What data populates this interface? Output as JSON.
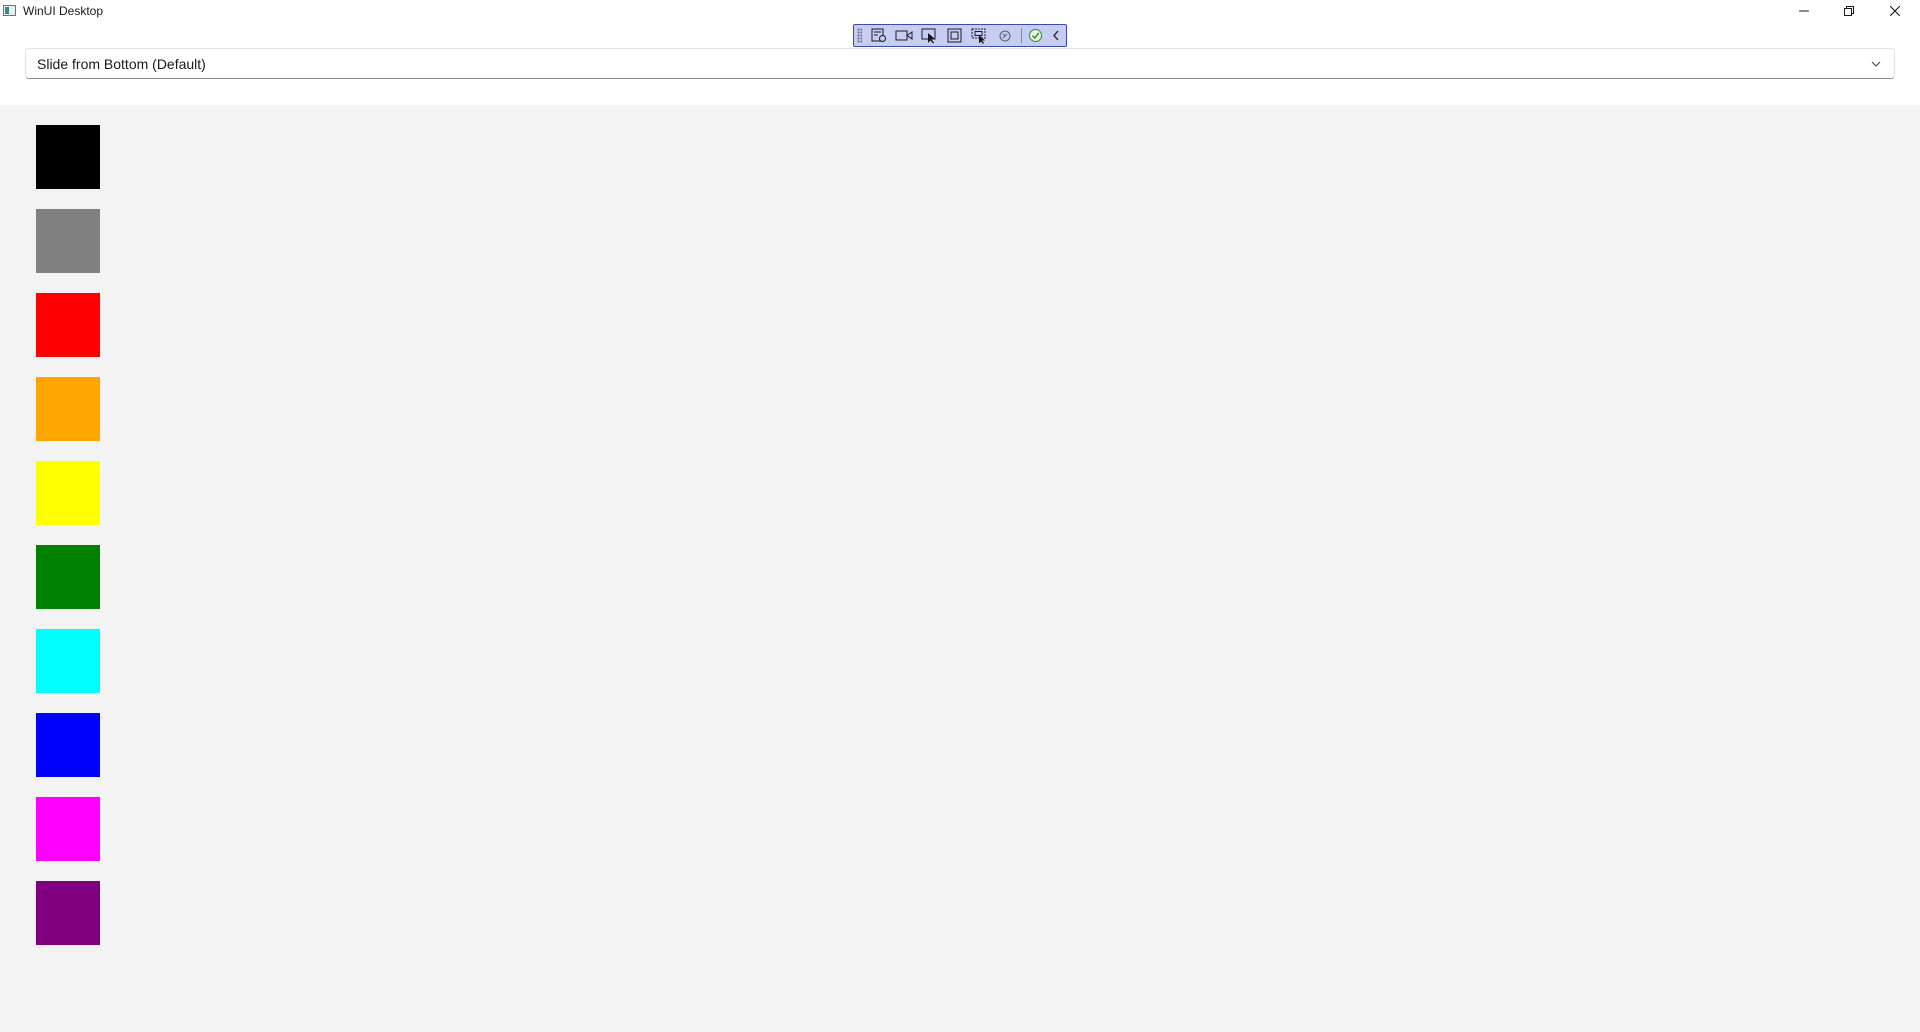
{
  "window": {
    "title": "WinUI Desktop"
  },
  "title_bar_buttons": {
    "minimize": "minimize-icon",
    "maximize": "restore-icon",
    "close": "close-icon"
  },
  "debug_toolbar": {
    "buttons": [
      "live-visual-tree-icon",
      "record-icon",
      "select-element-icon",
      "display-layout-adorners-icon",
      "track-focus-icon",
      "hot-reload-icon",
      "accessibility-check-icon",
      "collapse-toolbar-icon"
    ]
  },
  "combo": {
    "selected": "Slide from Bottom (Default)",
    "icon": "chevron-down-icon"
  },
  "swatches": [
    {
      "name": "black",
      "color": "#000000"
    },
    {
      "name": "gray",
      "color": "#808080"
    },
    {
      "name": "red",
      "color": "#FF0000"
    },
    {
      "name": "orange",
      "color": "#FFA500"
    },
    {
      "name": "yellow",
      "color": "#FFFF00"
    },
    {
      "name": "green",
      "color": "#008000"
    },
    {
      "name": "cyan",
      "color": "#00FFFF"
    },
    {
      "name": "blue",
      "color": "#0000FF"
    },
    {
      "name": "magenta",
      "color": "#FF00FF"
    },
    {
      "name": "purple",
      "color": "#800080"
    }
  ]
}
